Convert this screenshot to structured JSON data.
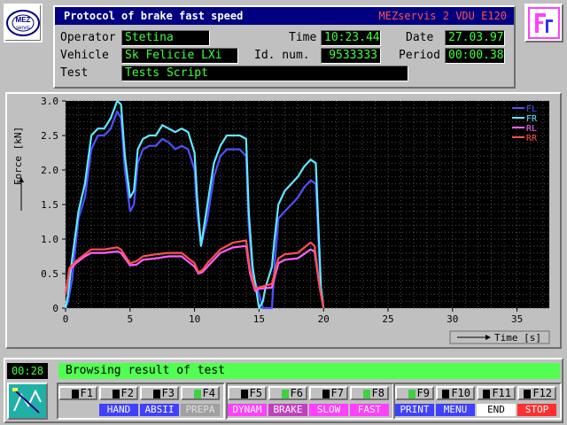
{
  "header": {
    "title": "Protocol of brake fast speed",
    "system": "MEZservis 2 VDU E120",
    "operator_label": "Operator",
    "operator": "Stetina",
    "time_label": "Time",
    "time": "10:23.44",
    "date_label": "Date",
    "date": "27.03.97",
    "vehicle_label": "Vehicle",
    "vehicle": "Sk Felicie LXi",
    "idnum_label": "Id. num.",
    "idnum": "9533333",
    "period_label": "Period",
    "period": "00:00.38",
    "test_label": "Test",
    "test": "Tests Script"
  },
  "logos": {
    "left_text": "MEZ servis",
    "right_text": "Fr"
  },
  "status": {
    "clock": "00:28",
    "message": "Browsing result of test"
  },
  "fkeys": [
    {
      "key": "F1",
      "label": "",
      "led": false,
      "label_color": "#4040ff"
    },
    {
      "key": "F2",
      "label": "HAND",
      "led": false,
      "label_color": "#4040ff"
    },
    {
      "key": "F3",
      "label": "ABSII",
      "led": false,
      "label_color": "#4040ff"
    },
    {
      "key": "F4",
      "label": "PREPA",
      "led": true,
      "label_color": "#a0a0a0"
    },
    {
      "key": "F5",
      "label": "DYNAM",
      "led": false,
      "label_color": "#ff40ff"
    },
    {
      "key": "F6",
      "label": "BRAKE",
      "led": true,
      "label_color": "#c040c0"
    },
    {
      "key": "F7",
      "label": "SLOW",
      "led": false,
      "label_color": "#ff40ff"
    },
    {
      "key": "F8",
      "label": "FAST",
      "led": true,
      "label_color": "#ff40ff"
    },
    {
      "key": "F9",
      "label": "PRINT",
      "led": true,
      "label_color": "#4040ff"
    },
    {
      "key": "F10",
      "label": "MENU",
      "led": false,
      "label_color": "#4040ff"
    },
    {
      "key": "F11",
      "label": "END",
      "led": false,
      "label_color": "#0000c0"
    },
    {
      "key": "F12",
      "label": "STOP",
      "led": false,
      "label_color": "#ff3030"
    }
  ],
  "chart_data": {
    "type": "line",
    "ylabel": "Force [kN]",
    "xlabel": "Time [s]",
    "xlim": [
      0,
      37.5
    ],
    "ylim": [
      0,
      3.0
    ],
    "xticks": [
      0,
      5,
      10,
      15,
      20,
      25,
      30,
      35
    ],
    "yticks": [
      0,
      0.5,
      1.0,
      1.5,
      2.0,
      2.5,
      3.0
    ],
    "ytick_labels": [
      "0",
      "0.5",
      "1.0",
      "1.5",
      "2.0",
      "2.5",
      "3.0"
    ],
    "legend_position": "top-right",
    "grid": true,
    "series": [
      {
        "name": "FL",
        "color": "#5050ff",
        "x": [
          0,
          0.2,
          0.5,
          1,
          1.5,
          2,
          2.5,
          3,
          3.5,
          4,
          4.3,
          4.6,
          5,
          5.3,
          5.6,
          6,
          6.5,
          7,
          7.5,
          8,
          8.5,
          9,
          9.5,
          10,
          10.2,
          10.5,
          11,
          11.5,
          12,
          12.5,
          13,
          13.5,
          14,
          14.2,
          14.5,
          15,
          15.3,
          15.5,
          16,
          16.2,
          16.5,
          17,
          17.5,
          18,
          18.5,
          19,
          19.4,
          19.6,
          19.8,
          20
        ],
        "y": [
          0,
          0.1,
          0.4,
          1.3,
          1.6,
          2.3,
          2.5,
          2.5,
          2.6,
          2.85,
          2.75,
          2.0,
          1.4,
          1.5,
          2.1,
          2.3,
          2.35,
          2.35,
          2.45,
          2.4,
          2.3,
          2.35,
          2.3,
          2.0,
          1.4,
          0.9,
          1.3,
          1.9,
          2.2,
          2.3,
          2.3,
          2.3,
          2.2,
          1.2,
          0.5,
          0.2,
          0.0,
          0.0,
          0.0,
          0.6,
          1.3,
          1.4,
          1.5,
          1.6,
          1.75,
          1.85,
          1.8,
          1.0,
          0.2,
          0.0
        ]
      },
      {
        "name": "FR",
        "color": "#60e8ff",
        "x": [
          0,
          0.2,
          0.5,
          1,
          1.5,
          2,
          2.5,
          3,
          3.5,
          4,
          4.3,
          4.6,
          5,
          5.3,
          5.6,
          6,
          6.5,
          7,
          7.5,
          8,
          8.5,
          9,
          9.5,
          10,
          10.2,
          10.5,
          11,
          11.5,
          12,
          12.5,
          13,
          13.5,
          14,
          14.2,
          14.5,
          15,
          15.3,
          15.5,
          16,
          16.2,
          16.5,
          17,
          17.5,
          18,
          18.5,
          19,
          19.4,
          19.6,
          19.8,
          20
        ],
        "y": [
          0,
          0.2,
          0.7,
          1.4,
          1.8,
          2.5,
          2.6,
          2.6,
          2.75,
          3.0,
          2.95,
          2.2,
          1.6,
          1.7,
          2.3,
          2.45,
          2.5,
          2.5,
          2.65,
          2.6,
          2.55,
          2.6,
          2.55,
          2.25,
          1.6,
          0.9,
          1.5,
          2.1,
          2.35,
          2.5,
          2.5,
          2.5,
          2.45,
          1.4,
          0.6,
          0.0,
          0.1,
          0.3,
          0.6,
          1.0,
          1.5,
          1.7,
          1.8,
          1.9,
          2.05,
          2.15,
          2.1,
          1.2,
          0.3,
          0.0
        ]
      },
      {
        "name": "RL",
        "color": "#ff60ff",
        "x": [
          0,
          0.3,
          0.8,
          1.5,
          2,
          3,
          4,
          4.3,
          5,
          5.5,
          6,
          7,
          8,
          9,
          10,
          10.3,
          10.6,
          11,
          12,
          13,
          14,
          14.3,
          14.7,
          15,
          16,
          16.5,
          17,
          18,
          19,
          19.3,
          19.7,
          20
        ],
        "y": [
          0.2,
          0.55,
          0.65,
          0.75,
          0.8,
          0.8,
          0.82,
          0.8,
          0.62,
          0.63,
          0.7,
          0.72,
          0.75,
          0.75,
          0.6,
          0.5,
          0.52,
          0.6,
          0.8,
          0.88,
          0.9,
          0.5,
          0.25,
          0.28,
          0.3,
          0.65,
          0.7,
          0.72,
          0.85,
          0.82,
          0.3,
          0.0
        ]
      },
      {
        "name": "RR",
        "color": "#ff5050",
        "x": [
          0,
          0.3,
          0.8,
          1.5,
          2,
          3,
          4,
          4.3,
          5,
          5.5,
          6,
          7,
          8,
          9,
          10,
          10.3,
          10.6,
          11,
          12,
          13,
          14,
          14.3,
          14.7,
          15,
          16,
          16.5,
          17,
          18,
          19,
          19.3,
          19.7,
          20
        ],
        "y": [
          0.2,
          0.58,
          0.68,
          0.78,
          0.85,
          0.85,
          0.88,
          0.85,
          0.65,
          0.68,
          0.75,
          0.78,
          0.8,
          0.8,
          0.65,
          0.52,
          0.55,
          0.65,
          0.85,
          0.95,
          0.98,
          0.55,
          0.28,
          0.3,
          0.35,
          0.72,
          0.78,
          0.8,
          0.95,
          0.9,
          0.3,
          0.0
        ]
      }
    ]
  }
}
